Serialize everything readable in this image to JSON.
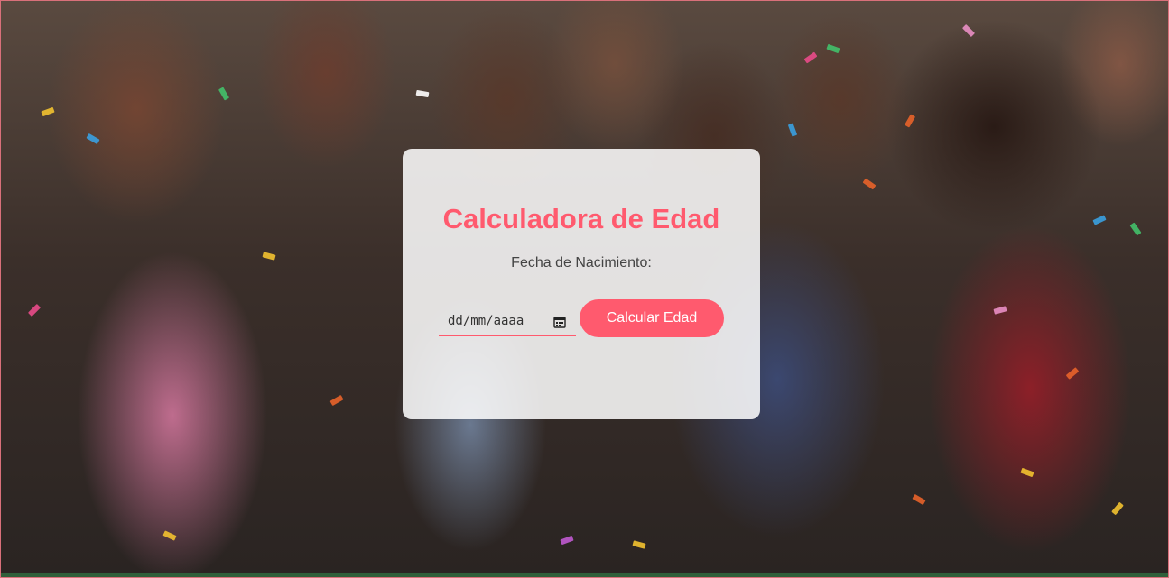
{
  "page": {
    "title": "Calculadora de Edad"
  },
  "form": {
    "label": "Fecha de Nacimiento:",
    "date_placeholder": "dd/mm/aaaa",
    "button_label": "Calcular Edad"
  },
  "icons": {
    "calendar": "calendar-icon"
  },
  "colors": {
    "accent": "#ff5a6e"
  }
}
